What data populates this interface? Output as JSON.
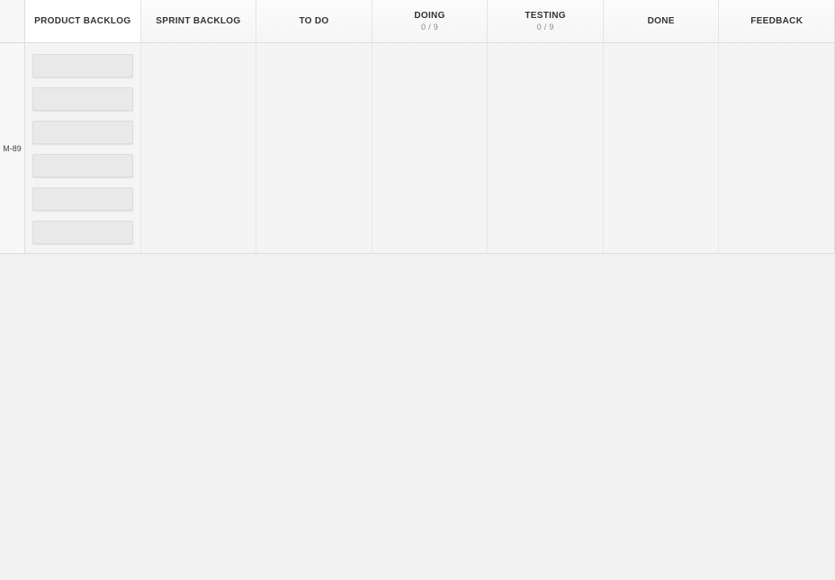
{
  "columns": [
    {
      "label": "PRODUCT BACKLOG",
      "sub": null,
      "active": true
    },
    {
      "label": "SPRINT BACKLOG",
      "sub": null,
      "active": false
    },
    {
      "label": "TO DO",
      "sub": null,
      "active": false
    },
    {
      "label": "DOING",
      "sub": "0 / 9",
      "active": false
    },
    {
      "label": "TESTING",
      "sub": "0 / 9",
      "active": false
    },
    {
      "label": "DONE",
      "sub": null,
      "active": false
    },
    {
      "label": "FEEDBACK",
      "sub": null,
      "active": false
    }
  ],
  "row": {
    "label": "M-89",
    "card_count": 6
  }
}
